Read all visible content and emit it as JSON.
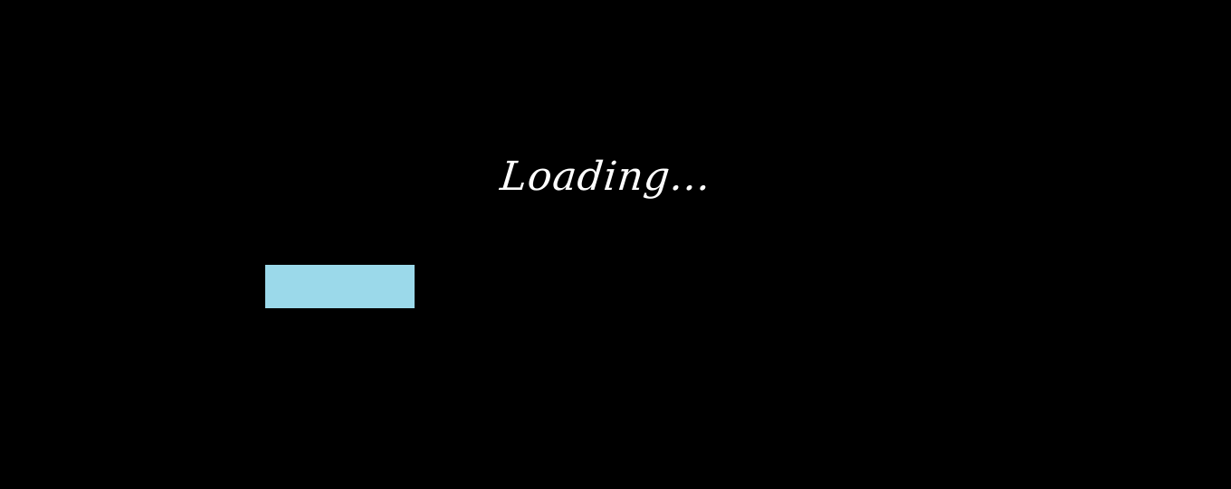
{
  "loading": {
    "label": "Loading..."
  },
  "progress": {
    "fraction": 0.213,
    "fill_color": "#9bd9ea"
  },
  "colors": {
    "background": "#000000",
    "text": "#ffffff"
  }
}
